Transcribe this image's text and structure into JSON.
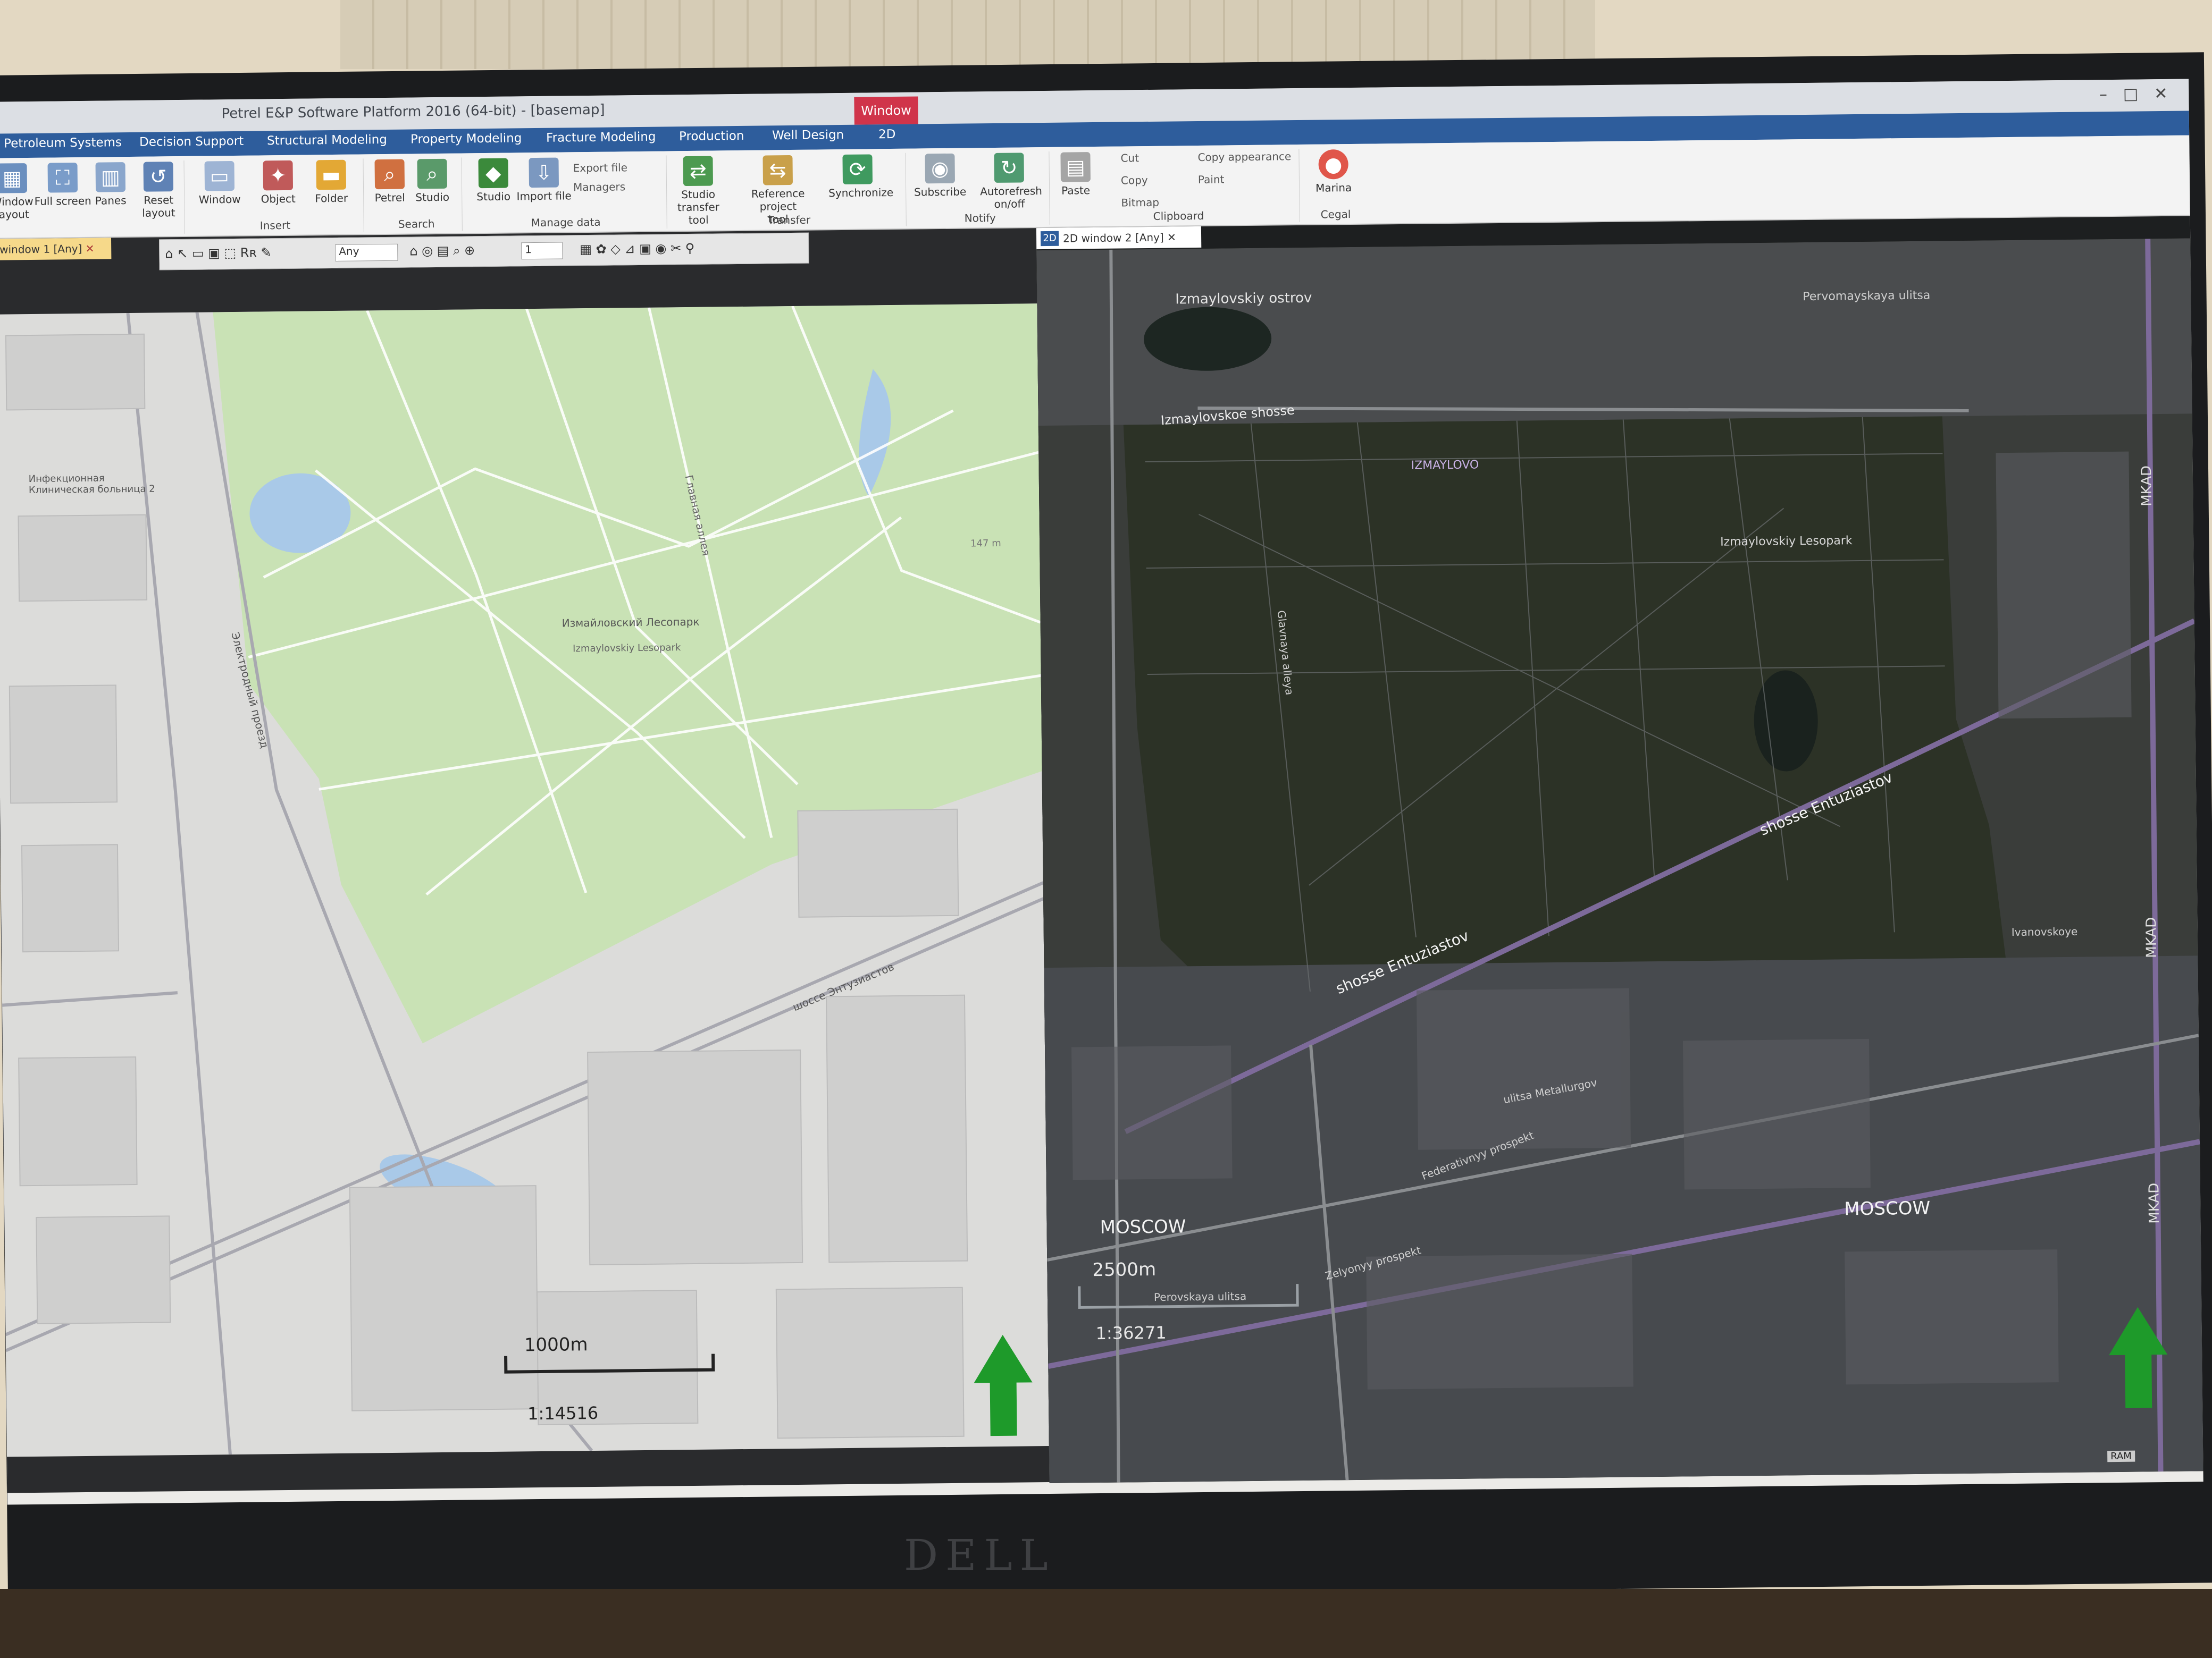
{
  "window": {
    "title": "Petrel E&P Software Platform 2016 (64-bit) - [basemap]",
    "contextual_tab": "Window"
  },
  "tabs": [
    "Petroleum Systems",
    "Decision Support",
    "Structural Modeling",
    "Property Modeling",
    "Fracture Modeling",
    "Production",
    "Well Design",
    "2D"
  ],
  "ribbon": {
    "window_layout": "Window layout",
    "full_screen": "Full screen",
    "panes": "Panes",
    "reset_layout": "Reset layout",
    "window": "Window",
    "object": "Object",
    "folder": "Folder",
    "insert_group": "Insert",
    "petrel": "Petrel",
    "studio_search": "Studio",
    "search_group": "Search",
    "studio": "Studio",
    "import_file": "Import file",
    "export_file": "Export file",
    "managers": "Managers",
    "manage_data_group": "Manage data",
    "studio_transfer_tool": "Studio transfer tool",
    "reference_project_tool": "Reference project tool",
    "synchronize": "Synchronize",
    "transfer_group": "Transfer",
    "subscribe": "Subscribe",
    "autorefresh": "Autorefresh on/off",
    "notify_group": "Notify",
    "paste": "Paste",
    "cut": "Cut",
    "copy": "Copy",
    "bitmap": "Bitmap",
    "copy_appearance": "Copy appearance",
    "paint": "Paint",
    "clipboard_group": "Clipboard",
    "marina": "Marina",
    "cegal_group": "Cegal"
  },
  "left_window": {
    "tab": "window 1 [Any]",
    "toolbar_filter": "Any",
    "toolbar_value": "1",
    "scale_bar": "1000m",
    "scale_ratio": "1:14516",
    "labels": {
      "park_ru": "Измайловский Лесопарк",
      "park_en": "Izmaylovskiy Lesopark",
      "road1": "шоссе Энтузиастов",
      "road2": "Главная аллея",
      "road3": "Электродный проезд",
      "hospital": "Инфекционная Клиническая больница 2",
      "elev": "147 m"
    }
  },
  "right_window": {
    "tab": "2D window 2 [Any]",
    "scale_bar": "2500m",
    "scale_ratio": "1:36271",
    "status": "RAM",
    "labels": {
      "island": "Izmaylovskiy ostrov",
      "shosse": "Izmaylovskoe shosse",
      "izmaylovo": "IZMAYLOVO",
      "lesopark": "Izmaylovskiy Lesopark",
      "entuziastov1": "shosse Entuziastov",
      "entuziastov2": "shosse Entuziastov",
      "moscow1": "MOSCOW",
      "moscow2": "MOSCOW",
      "mkad1": "MKAD",
      "mkad2": "MKAD",
      "mkad3": "MKAD",
      "pervomayskaya": "Pervomayskaya ulitsa",
      "perovskaya": "Perovskaya ulitsa",
      "federativny": "Federativnyy prospekt",
      "zelyonyy": "Zelyonyy prospekt",
      "glavnaya": "Glavnaya alleya",
      "metallurgov": "ulitsa Metallurgov",
      "ivanovskoye": "Ivanovskoye"
    }
  },
  "monitor": {
    "brand": "DELL"
  }
}
